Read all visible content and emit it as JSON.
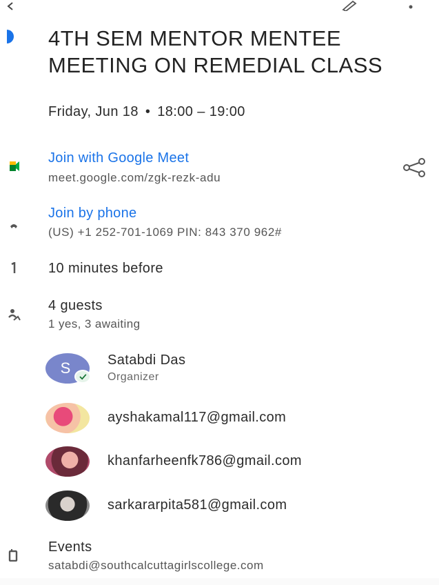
{
  "header": {
    "back_icon": "back-arrow-icon",
    "edit_icon": "pencil-icon",
    "more_icon": "more-vert-icon"
  },
  "event": {
    "color": "#1a73e8",
    "title": "4TH SEM MENTOR MENTEE MEETING ON REMEDIAL CLASS",
    "date": "Friday, Jun 18",
    "separator": "•",
    "time_range": "18:00 – 19:00"
  },
  "meet": {
    "label": "Join with Google Meet",
    "url": "meet.google.com/zgk-rezk-adu",
    "share_icon": "share-icon"
  },
  "phone": {
    "label": "Join by phone",
    "details": "(US) +1 252-701-1069 PIN: 843 370 962#"
  },
  "reminder": {
    "text": "10 minutes before"
  },
  "guests": {
    "count_label": "4 guests",
    "status_label": "1 yes, 3 awaiting",
    "organizer": {
      "name": "Satabdi Das",
      "role": "Organizer",
      "initial": "S",
      "avatar_color": "#7986cb"
    },
    "list": [
      {
        "email": "ayshakamal117@gmail.com"
      },
      {
        "email": "khanfarheenfk786@gmail.com"
      },
      {
        "email": "sarkararpita581@gmail.com"
      }
    ]
  },
  "calendar": {
    "label": "Events",
    "owner": "satabdi@southcalcuttagirlscollege.com"
  }
}
